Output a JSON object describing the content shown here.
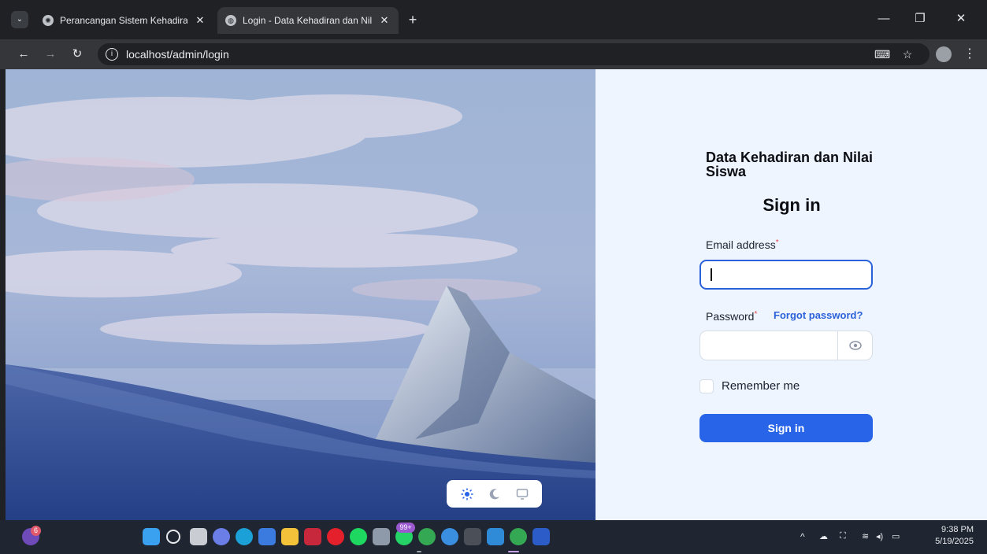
{
  "browser": {
    "tabs": [
      {
        "title": "Perancangan Sistem Kehadiran",
        "active": false
      },
      {
        "title": "Login - Data Kehadiran dan Nil",
        "active": true
      }
    ],
    "url": "localhost/admin/login",
    "close_glyph": "✕",
    "new_tab_glyph": "+"
  },
  "login": {
    "app_title": "Data Kehadiran dan Nilai Siswa",
    "heading": "Sign in",
    "email_label": "Email address",
    "email_value": "",
    "password_label": "Password",
    "password_value": "",
    "required_mark": "*",
    "forgot_password": "Forgot password?",
    "remember_me": "Remember me",
    "remember_checked": false,
    "submit_label": "Sign in"
  },
  "theme_switcher": {
    "options": [
      "light-icon",
      "dark-icon",
      "system-icon"
    ],
    "selected": "light-icon"
  },
  "taskbar": {
    "copilot_badge": "6",
    "whatsapp_badge": "99+",
    "time": "9:38 PM",
    "date": "5/19/2025"
  },
  "colors": {
    "accent": "#2864e7",
    "panel_bg": "#eff5fe",
    "required": "#e5484d"
  }
}
